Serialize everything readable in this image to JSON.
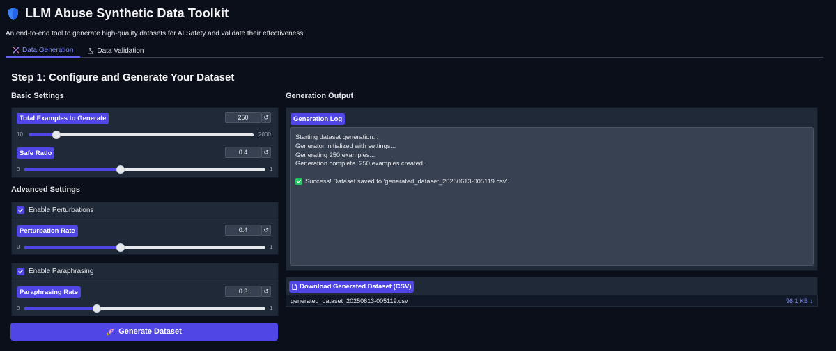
{
  "app": {
    "title": "LLM Abuse Synthetic Data Toolkit",
    "subtitle": "An end-to-end tool to generate high-quality datasets for AI Safety and validate their effectiveness."
  },
  "tabs": [
    {
      "label": "Data Generation",
      "icon": "dna-icon",
      "active": true
    },
    {
      "label": "Data Validation",
      "icon": "microscope-icon",
      "active": false
    }
  ],
  "step_title": "Step 1: Configure and Generate Your Dataset",
  "basic": {
    "heading": "Basic Settings",
    "total": {
      "label": "Total Examples to Generate",
      "value": "250",
      "min": "10",
      "max": "2000",
      "fraction": 0.12
    },
    "safe": {
      "label": "Safe Ratio",
      "value": "0.4",
      "min": "0",
      "max": "1",
      "fraction": 0.4
    }
  },
  "advanced": {
    "heading": "Advanced Settings",
    "perturb": {
      "checkbox": "Enable Perturbations",
      "checked": true,
      "label": "Perturbation Rate",
      "value": "0.4",
      "min": "0",
      "max": "1",
      "fraction": 0.4
    },
    "para": {
      "checkbox": "Enable Paraphrasing",
      "checked": true,
      "label": "Paraphrasing Rate",
      "value": "0.3",
      "min": "0",
      "max": "1",
      "fraction": 0.3
    }
  },
  "generate_button": "Generate Dataset",
  "output": {
    "heading": "Generation Output",
    "log_label": "Generation Log",
    "log_lines": [
      "Starting dataset generation...",
      "Generator initialized with settings...",
      "Generating 250 examples...",
      "Generation complete. 250 examples created."
    ],
    "success": "Success! Dataset saved to 'generated_dataset_20250613-005119.csv'.",
    "download_label": "Download Generated Dataset (CSV)",
    "file_name": "generated_dataset_20250613-005119.csv",
    "file_size": "96.1 KB ↓"
  },
  "colors": {
    "accent": "#4f46e5",
    "background": "#0b0f19",
    "panel": "#1f2937"
  }
}
